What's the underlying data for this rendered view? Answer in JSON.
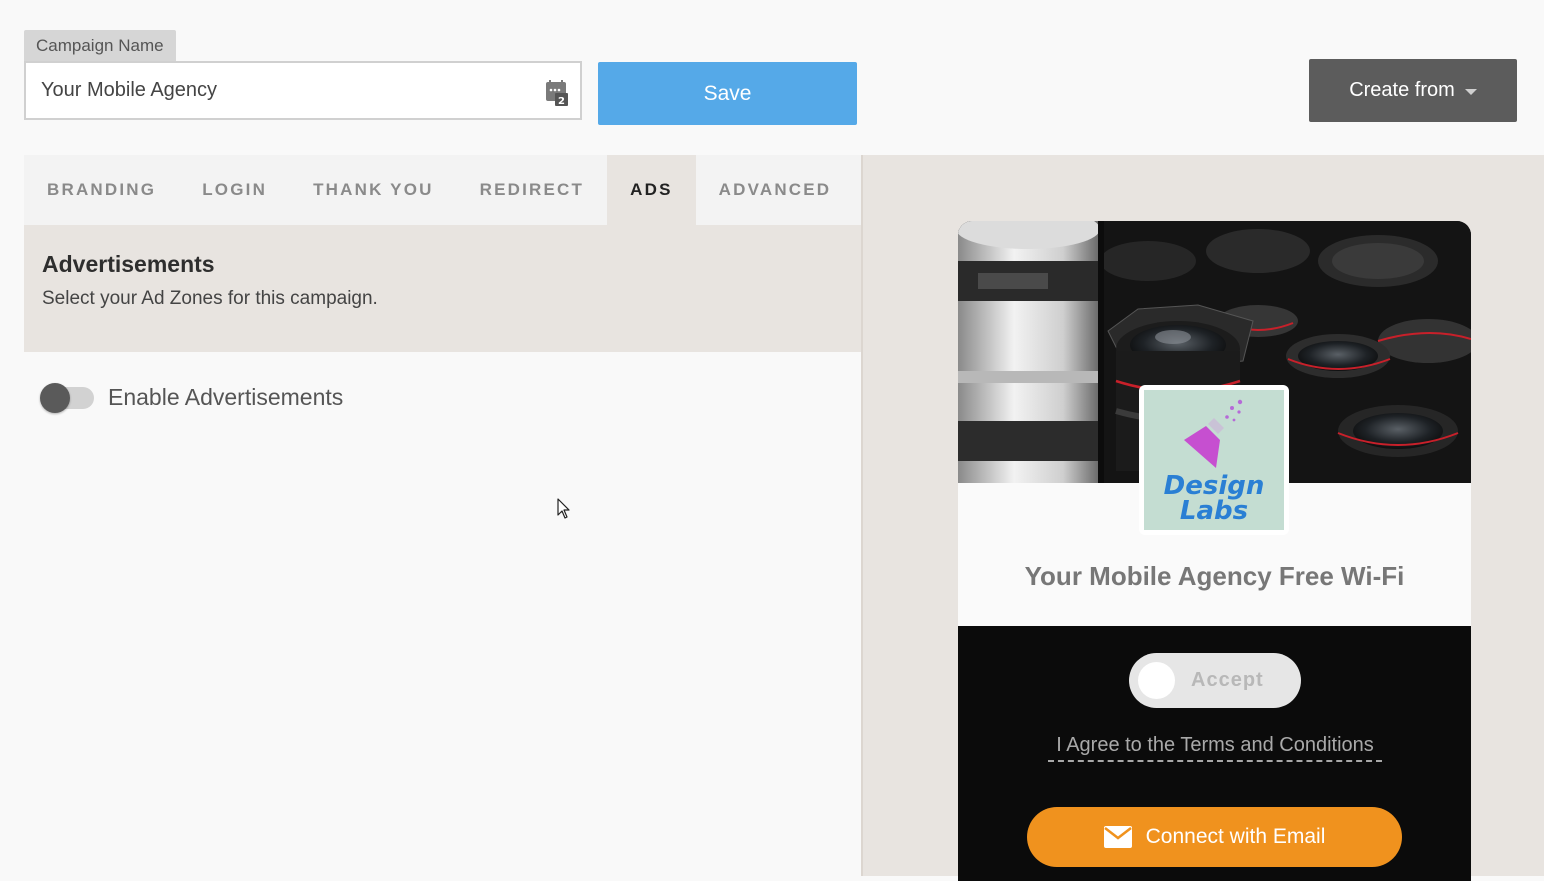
{
  "campaign": {
    "label": "Campaign Name",
    "value": "Your Mobile Agency"
  },
  "toolbar": {
    "save_label": "Save",
    "create_label": "Create from"
  },
  "tabs": [
    {
      "label": "BRANDING",
      "active": false
    },
    {
      "label": "LOGIN",
      "active": false
    },
    {
      "label": "THANK YOU",
      "active": false
    },
    {
      "label": "REDIRECT",
      "active": false
    },
    {
      "label": "ADS",
      "active": true
    },
    {
      "label": "ADVANCED",
      "active": false
    }
  ],
  "section": {
    "title": "Advertisements",
    "description": "Select your Ad Zones for this campaign."
  },
  "toggle": {
    "label": "Enable Advertisements",
    "enabled": false
  },
  "preview": {
    "logo_line1": "Design",
    "logo_line2": "Labs",
    "title": "Your Mobile Agency Free Wi-Fi",
    "accept_label": "Accept",
    "terms_label": "I Agree to the Terms and Conditions",
    "connect_label": "Connect with Email"
  },
  "colors": {
    "save": "#55a9e8",
    "create": "#5c5c5c",
    "connect": "#f0921e",
    "logo_bg": "#c4ddd2",
    "logo_text": "#2a7fd4"
  },
  "icons": {
    "campaign_picker": "number-picker-icon",
    "create_caret": "caret-down-icon",
    "connect": "envelope-icon"
  }
}
